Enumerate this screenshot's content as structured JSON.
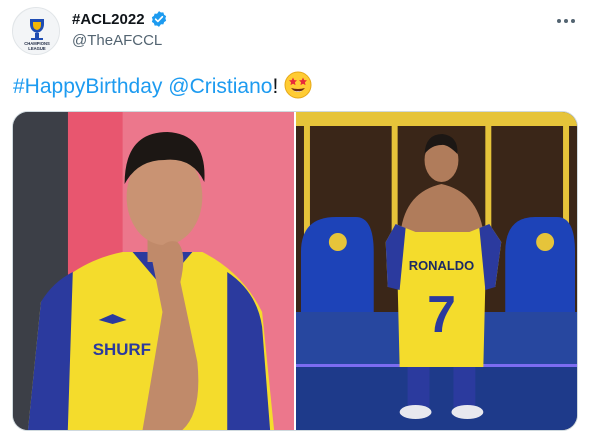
{
  "account": {
    "display_name": "#ACL2022",
    "handle": "@TheAFCCL",
    "avatar_icon": "afc-champions-league-logo",
    "avatar_text": "CHAMPIONS LEAGUE"
  },
  "tweet": {
    "hashtag": "#HappyBirthday",
    "mention": "@Cristiano",
    "trailing": "!",
    "emoji": "star-struck-emoji"
  },
  "media": {
    "photo1": {
      "sponsor": "SHURF"
    },
    "photo2": {
      "shirt_name": "RONALDO",
      "shirt_number": "7"
    }
  },
  "colors": {
    "accent": "#1d9bf0",
    "secondary_text": "#536471",
    "kit_yellow": "#f4dc2c",
    "kit_blue": "#2b3a9e"
  }
}
